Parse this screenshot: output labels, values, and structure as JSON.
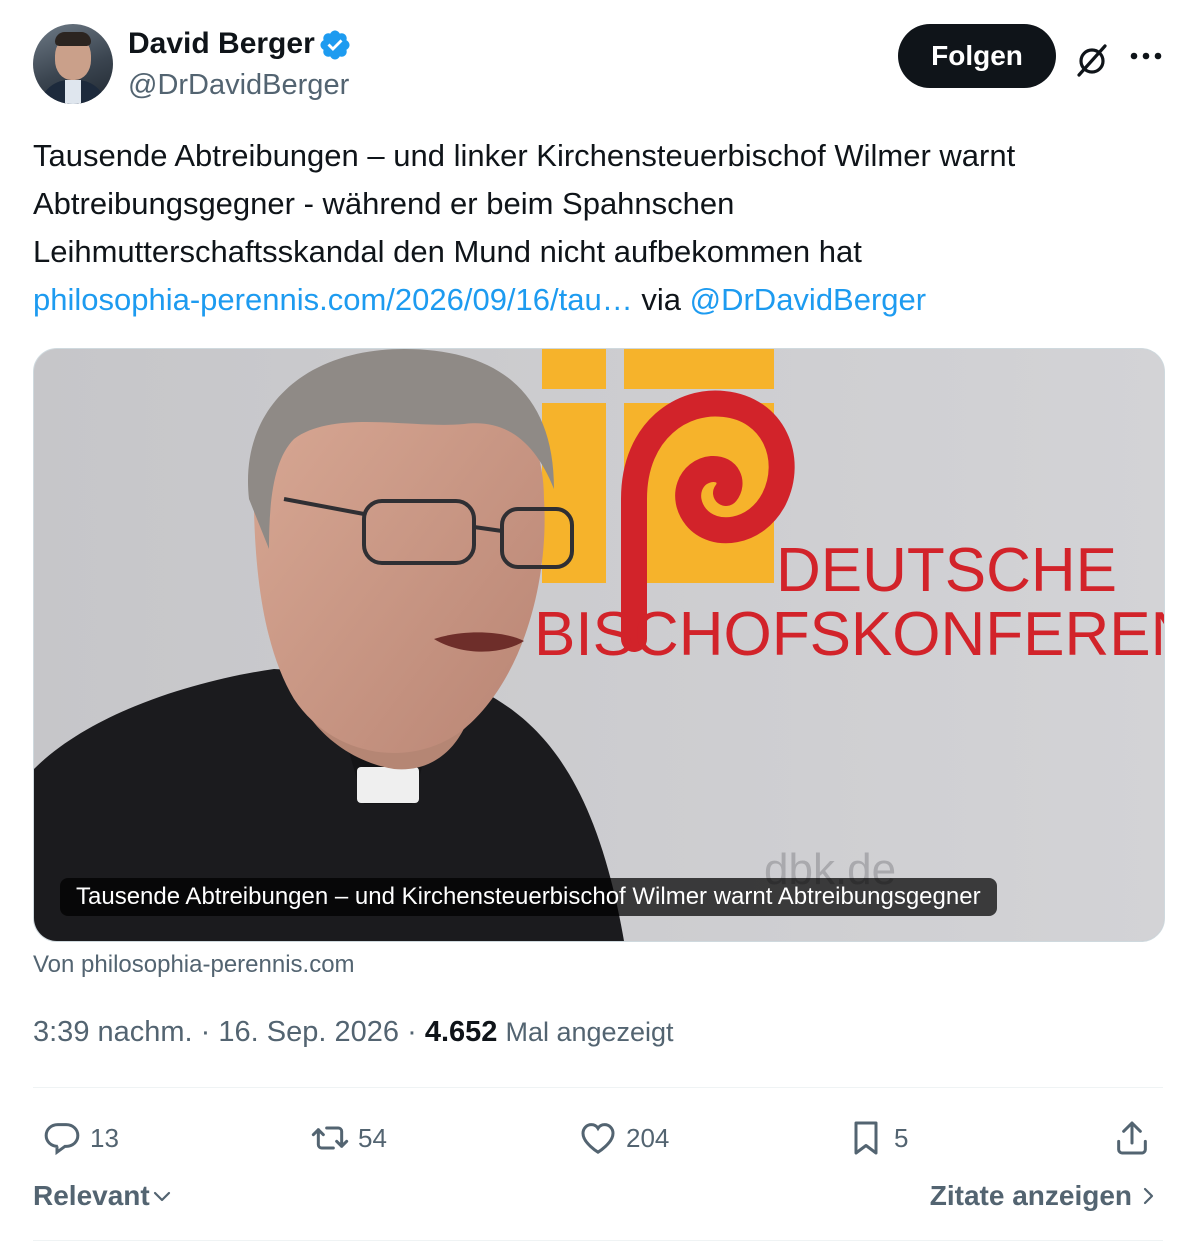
{
  "author": {
    "name": "David Berger",
    "handle": "@DrDavidBerger",
    "verified": true
  },
  "header": {
    "follow_label": "Folgen",
    "grok_icon": "grok-icon",
    "more_icon": "more-icon"
  },
  "tweet": {
    "line1": "Tausende Abtreibungen – und linker Kirchensteuerbischof Wilmer warnt",
    "line2": "Abtreibungsgegner - während er beim Spahnschen",
    "line3": "Leihmutterschaftsskandal  den Mund nicht aufbekommen hat",
    "link": "philosophia-perennis.com/2026/09/16/tau…",
    "via": "via",
    "mention": "@DrDavidBerger"
  },
  "card": {
    "logo_line1": "DEUTSCHE",
    "logo_line2": "BISCHOFSKONFERENZ",
    "watermark": "dbk.de",
    "caption": "Tausende Abtreibungen – und Kirchensteuerbischof Wilmer warnt Abtreibungsgegner",
    "source": "Von philosophia-perennis.com"
  },
  "meta": {
    "time": "3:39 nachm.",
    "sep1": "·",
    "date": "16. Sep. 2026",
    "sep2": "·",
    "views": "4.652",
    "views_label": "Mal angezeigt"
  },
  "actions": {
    "replies": "13",
    "retweets": "54",
    "likes": "204",
    "bookmarks": "5"
  },
  "footer": {
    "relevant": "Relevant",
    "quotes": "Zitate anzeigen"
  },
  "colors": {
    "link": "#1d9bf0",
    "secondary": "#536471",
    "verified": "#1d9bf0",
    "logo_red": "#d2232a",
    "logo_yellow": "#f6b32b"
  }
}
